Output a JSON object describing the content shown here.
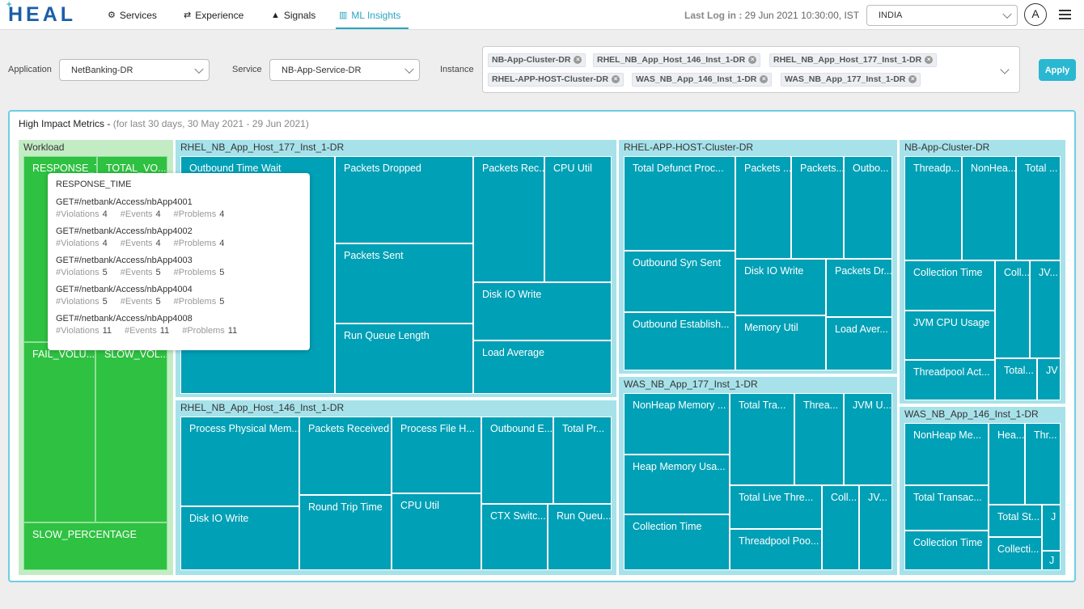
{
  "header": {
    "logo_text": "HEAL",
    "logo_mark": "+",
    "nav": [
      {
        "label": "Services",
        "icon": "gears-icon"
      },
      {
        "label": "Experience",
        "icon": "shuffle-icon"
      },
      {
        "label": "Signals",
        "icon": "warning-icon"
      },
      {
        "label": "ML Insights",
        "icon": "bar-chart-icon",
        "active": true
      }
    ],
    "last_login_label": "Last Log in :",
    "last_login_value": "29 Jun 2021 10:30:00, IST",
    "region": "INDIA",
    "avatar": "A"
  },
  "filters": {
    "application_label": "Application",
    "application_value": "NetBanking-DR",
    "service_label": "Service",
    "service_value": "NB-App-Service-DR",
    "instance_label": "Instance",
    "instances": [
      "NB-App-Cluster-DR",
      "RHEL_NB_App_Host_146_Inst_1-DR",
      "RHEL_NB_App_Host_177_Inst_1-DR",
      "RHEL-APP-HOST-Cluster-DR",
      "WAS_NB_App_146_Inst_1-DR",
      "WAS_NB_App_177_Inst_1-DR"
    ],
    "apply_label": "Apply"
  },
  "card": {
    "title": "High Impact Metrics -",
    "subtitle": "(for last 30 days, 30 May 2021 - 29 Jun 2021)"
  },
  "treemap": {
    "workload": {
      "title": "Workload",
      "tiles": [
        "RESPONSE_T...",
        "TOTAL_VO...",
        "FAIL_VOLU...",
        "SLOW_VOL...",
        "SLOW_PERCENTAGE"
      ]
    },
    "host177": {
      "title": "RHEL_NB_App_Host_177_Inst_1-DR",
      "tiles": [
        "Outbound Time Wait",
        "Packets Dropped",
        "Packets Rec...",
        "CPU Util",
        "Packets Sent",
        "Disk IO Write",
        "Run Queue Length",
        "Load Average"
      ]
    },
    "host146": {
      "title": "RHEL_NB_App_Host_146_Inst_1-DR",
      "tiles": [
        "Process Physical Mem...",
        "Packets Received",
        "Process File H...",
        "Outbound E...",
        "Total Pr...",
        "Disk IO Write",
        "Round Trip Time",
        "CPU Util",
        "CTX Switc...",
        "Run Queu..."
      ]
    },
    "cluster": {
      "title": "RHEL-APP-HOST-Cluster-DR",
      "tiles": [
        "Total Defunct Proc...",
        "Packets ...",
        "Packets...",
        "Outbo...",
        "Outbound Syn Sent",
        "Disk IO Write",
        "Packets Dr...",
        "Outbound Establish...",
        "Memory Util",
        "Load Aver..."
      ]
    },
    "was177": {
      "title": "WAS_NB_App_177_Inst_1-DR",
      "tiles": [
        "NonHeap Memory ...",
        "Total Tra...",
        "Threa...",
        "JVM U...",
        "Heap Memory Usa...",
        "Total Live Thre...",
        "Coll...",
        "JV...",
        "Collection Time",
        "Threadpool Poo..."
      ]
    },
    "nbcluster": {
      "title": "NB-App-Cluster-DR",
      "tiles": [
        "Threadp...",
        "NonHea...",
        "Total ...",
        "Collection Time",
        "Coll...",
        "JV...",
        "JVM CPU Usage",
        "Threadpool Act...",
        "Total...",
        "JV"
      ]
    },
    "was146": {
      "title": "WAS_NB_App_146_Inst_1-DR",
      "tiles": [
        "NonHeap Me...",
        "Hea...",
        "Thr...",
        "Total Transac...",
        "Total St...",
        "J",
        "Collection Time",
        "Collecti...",
        "J"
      ]
    }
  },
  "tooltip": {
    "title": "RESPONSE_TIME",
    "labels": {
      "violations": "#Violations",
      "events": "#Events",
      "problems": "#Problems"
    },
    "rows": [
      {
        "path": "GET#/netbank/Access/nbApp4001",
        "violations": "4",
        "events": "4",
        "problems": "4"
      },
      {
        "path": "GET#/netbank/Access/nbApp4002",
        "violations": "4",
        "events": "4",
        "problems": "4"
      },
      {
        "path": "GET#/netbank/Access/nbApp4003",
        "violations": "5",
        "events": "5",
        "problems": "5"
      },
      {
        "path": "GET#/netbank/Access/nbApp4004",
        "violations": "5",
        "events": "5",
        "problems": "5"
      },
      {
        "path": "GET#/netbank/Access/nbApp4008",
        "violations": "11",
        "events": "11",
        "problems": "11"
      }
    ]
  },
  "colors": {
    "accent": "#2aa5bd",
    "tile": "#00a0b6",
    "workload": "#2fc142",
    "group_bg": "#a7e2ea"
  }
}
